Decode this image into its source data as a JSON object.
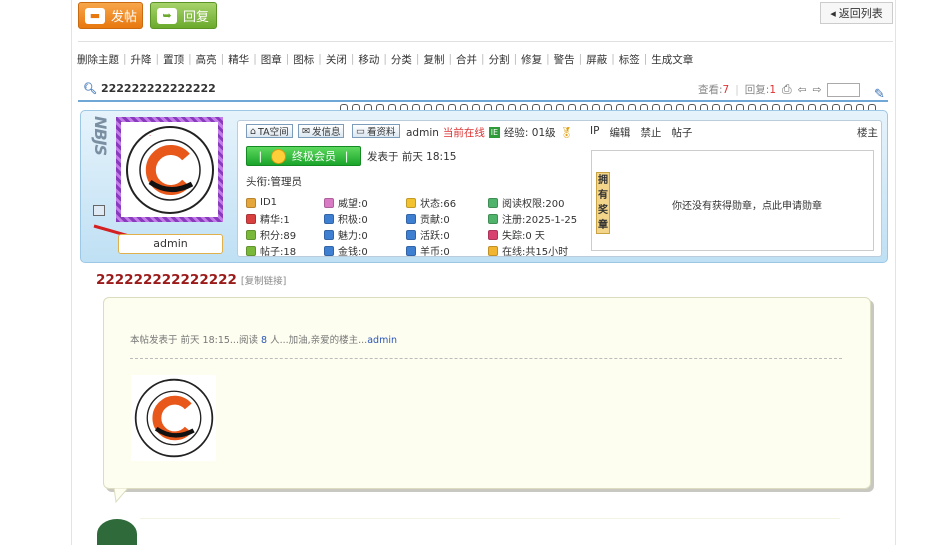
{
  "top_buttons": {
    "post_label": "发帖",
    "reply_label": "回复",
    "back_label": "返回列表"
  },
  "toolbar": [
    "删除主题",
    "升降",
    "置顶",
    "高亮",
    "精华",
    "图章",
    "图标",
    "关闭",
    "移动",
    "分类",
    "复制",
    "合并",
    "分割",
    "修复",
    "警告",
    "屏蔽",
    "标签",
    "生成文章"
  ],
  "thread": {
    "title": "222222222222222",
    "views_label": "查看:",
    "views": "7",
    "replies_label": "回复:",
    "replies": "1"
  },
  "author": {
    "name": "admin",
    "space_btn": "TA空间",
    "message_btn": "发信息",
    "profile_btn": "看资料",
    "online_status": "当前在线",
    "exp": "经验: 01级",
    "actions": [
      "IP",
      "编辑",
      "禁止",
      "帖子"
    ],
    "floor": "楼主",
    "vip_label": "终极会员",
    "posted_at": "发表于 前天 18:15",
    "title_line": "头衔:管理员",
    "stats": [
      {
        "text": "ID1",
        "color": "#e5a73b"
      },
      {
        "text": "威望:0",
        "color": "#d87ac4"
      },
      {
        "text": "状态:66",
        "color": "#f2c230"
      },
      {
        "text": "阅读权限:200",
        "color": "#4fb36b"
      },
      {
        "text": "精华:1",
        "color": "#d84040"
      },
      {
        "text": "积极:0",
        "color": "#3f7fd1"
      },
      {
        "text": "贡献:0",
        "color": "#3f7fd1"
      },
      {
        "text": "注册:2025-1-25",
        "color": "#4fb36b"
      },
      {
        "text": "积分:89",
        "color": "#7ab83a"
      },
      {
        "text": "魅力:0",
        "color": "#3f7fd1"
      },
      {
        "text": "活跃:0",
        "color": "#3f7fd1"
      },
      {
        "text": "失踪:0 天",
        "color": "#d84070"
      },
      {
        "text": "帖子:18",
        "color": "#7ab83a"
      },
      {
        "text": "金钱:0",
        "color": "#3f7fd1"
      },
      {
        "text": "羊币:0",
        "color": "#3f7fd1"
      },
      {
        "text": "在线:共15小时",
        "color": "#f2b530"
      }
    ],
    "medal_label": "拥有奖章",
    "medal_message": "你还没有获得勋章，点此申请勋章"
  },
  "post": {
    "title": "222222222222222",
    "copy_link": "[复制链接]",
    "meta_prefix": "本帖发表于 前天 18:15...阅读 ",
    "meta_count": "8",
    "meta_mid": " 人...加油,亲爱的楼主...",
    "meta_author": "admin"
  }
}
